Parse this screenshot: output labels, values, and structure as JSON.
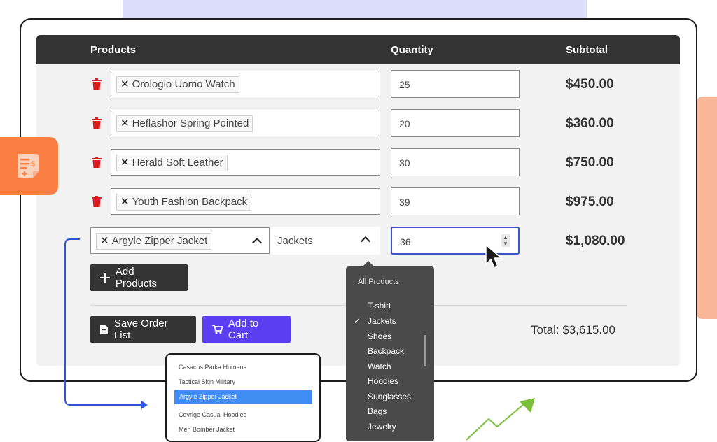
{
  "table": {
    "headers": {
      "products": "Products",
      "quantity": "Quantity",
      "subtotal": "Subtotal"
    },
    "rows": [
      {
        "product": "Orologio Uomo Watch",
        "quantity": "25",
        "subtotal": "$450.00"
      },
      {
        "product": "Heflashor Spring Pointed",
        "quantity": "20",
        "subtotal": "$360.00"
      },
      {
        "product": "Herald Soft Leather",
        "quantity": "30",
        "subtotal": "$750.00"
      },
      {
        "product": "Youth Fashion Backpack",
        "quantity": "39",
        "subtotal": "$975.00"
      }
    ],
    "editing_row": {
      "product": "Argyle Zipper Jacket",
      "category": "Jackets",
      "quantity": "36",
      "subtotal": "$1,080.00"
    },
    "remove_symbol": "✕"
  },
  "actions": {
    "add_products": "Add Products",
    "save_order_list": "Save Order List",
    "add_to_cart": "Add to Cart"
  },
  "total_label": "Total: $3,615.00",
  "category_dropdown": {
    "header": "All Products",
    "items": [
      "T-shirt",
      "Jackets",
      "Shoes",
      "Backpack",
      "Watch",
      "Hoodies",
      "Sunglasses",
      "Bags",
      "Jewelry"
    ],
    "selected": "Jackets"
  },
  "product_suggestions": {
    "items": [
      "Casacos Parka Homens",
      "Tactical Skin Military",
      "Argyle Zipper Jacket",
      "Covrlge Casual Hoodies",
      "Men Bomber Jacket"
    ],
    "highlighted": "Argyle Zipper Jacket"
  },
  "colors": {
    "header_bg": "#333333",
    "accent_blue": "#5a3ef0",
    "delete_red": "#d81b1b",
    "badge_orange": "#fa7e42",
    "highlight_blue": "#3f8cf3",
    "trend_green": "#7bbf3a"
  },
  "icons": [
    "trash-icon",
    "plus-icon",
    "document-icon",
    "cart-icon",
    "chevron-up-icon",
    "check-icon",
    "invoice-icon",
    "cursor-icon",
    "trend-arrow-icon"
  ]
}
